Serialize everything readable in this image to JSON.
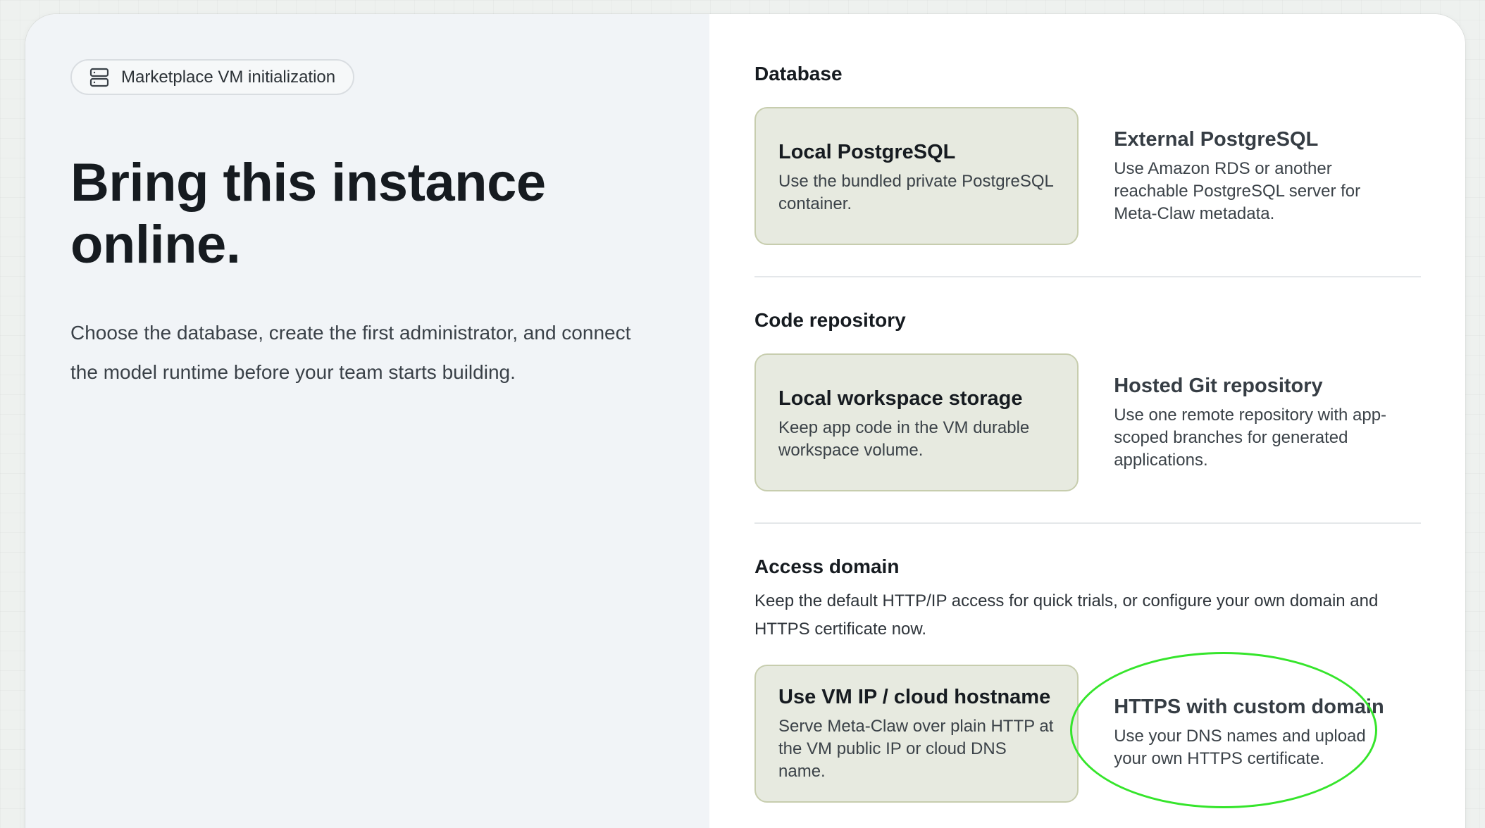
{
  "badge": {
    "icon": "server-icon",
    "label": "Marketplace VM initialization"
  },
  "hero": {
    "title_line1": "Bring this instance",
    "title_line2": "online.",
    "description_line1": "Choose the database, create the first administrator, and connect",
    "description_line2": "the model runtime before your team starts building."
  },
  "sections": {
    "database": {
      "title": "Database",
      "options": [
        {
          "title": "Local PostgreSQL",
          "text_line1": "Use the bundled private PostgreSQL",
          "text_line2": "container.",
          "selected": true
        },
        {
          "title": "External PostgreSQL",
          "text_line1": "Use Amazon RDS or another",
          "text_line2": "reachable PostgreSQL server for",
          "text_line3": "Meta-Claw metadata.",
          "selected": false
        }
      ]
    },
    "repository": {
      "title": "Code repository",
      "options": [
        {
          "title": "Local workspace storage",
          "text_line1": "Keep app code in the VM durable",
          "text_line2": "workspace volume.",
          "selected": true
        },
        {
          "title": "Hosted Git repository",
          "text_line1": "Use one remote repository with app-",
          "text_line2": "scoped branches for generated",
          "text_line3": "applications.",
          "selected": false
        }
      ]
    },
    "domain": {
      "title": "Access domain",
      "description_line1": "Keep the default HTTP/IP access for quick trials, or configure your own domain and",
      "description_line2": "HTTPS certificate now.",
      "options": [
        {
          "title": "Use VM IP / cloud hostname",
          "text_line1": "Serve Meta-Claw over plain HTTP at",
          "text_line2": "the VM public IP or cloud DNS",
          "text_line3": "name.",
          "selected": true
        },
        {
          "title": "HTTPS with custom domain",
          "text_line1": "Use your DNS names and upload",
          "text_line2": "your own HTTPS certificate.",
          "selected": false
        }
      ]
    }
  },
  "colors": {
    "selected_card_bg": "#e7eae0",
    "selected_card_border": "#c7cdae",
    "highlight_ring": "#35e52b",
    "left_panel_bg": "#f1f4f7"
  }
}
